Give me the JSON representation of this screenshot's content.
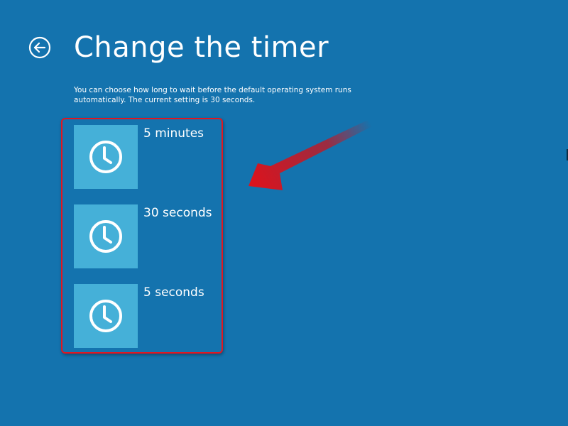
{
  "header": {
    "back_icon": "back-arrow-circle-icon",
    "title": "Change the timer"
  },
  "description": "You can choose how long to wait before the default operating system runs automatically. The current setting is 30 seconds.",
  "options": [
    {
      "label": "5 minutes",
      "icon": "clock-icon"
    },
    {
      "label": "30 seconds",
      "icon": "clock-icon"
    },
    {
      "label": "5 seconds",
      "icon": "clock-icon"
    }
  ],
  "annotation": {
    "highlight_color": "#e3161f",
    "arrow_color": "#d9131c"
  },
  "colors": {
    "background": "#1473ae",
    "tile": "#45b0d8",
    "text": "#ffffff"
  }
}
